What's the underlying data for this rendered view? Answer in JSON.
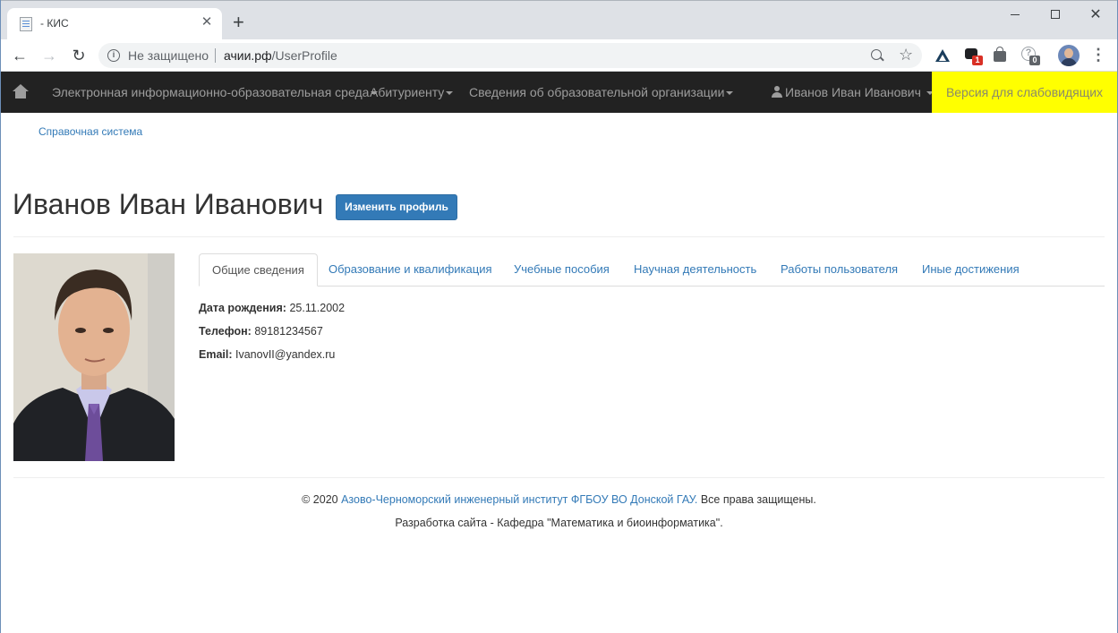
{
  "browser": {
    "tab_title": "- КИС",
    "tab_close": "✕",
    "new_tab": "+",
    "security_label": "Не защищено",
    "url_host": "ачии.рф",
    "url_path": "/UserProfile",
    "ext_badge_1": "1",
    "ext_badge_2": "0",
    "win_close": "✕"
  },
  "navbar": {
    "items": [
      {
        "label": "Электронная информационно-образовательная среда"
      },
      {
        "label": "Абитуриенту"
      },
      {
        "label": "Сведения об образовательной организации"
      }
    ],
    "user_name": "Иванов Иван Иванович",
    "a11y_label": "Версия для слабовидящих",
    "a11y_bg": "#ffff00",
    "bg_color": "#222222"
  },
  "page": {
    "help_link": "Справочная система",
    "title": "Иванов Иван Иванович",
    "edit_button": "Изменить профиль",
    "tabs": [
      {
        "label": "Общие сведения",
        "active": true
      },
      {
        "label": "Образование и квалификация"
      },
      {
        "label": "Учебные пособия"
      },
      {
        "label": "Научная деятельность"
      },
      {
        "label": "Работы пользователя"
      },
      {
        "label": "Иные достижения"
      }
    ],
    "info": {
      "dob_label": "Дата рождения:",
      "dob_value": "25.11.2002",
      "phone_label": "Телефон:",
      "phone_value": "89181234567",
      "email_label": "Email:",
      "email_value": "IvanovII@yandex.ru"
    }
  },
  "footer": {
    "copyright_prefix": "© 2020",
    "institute_link": "Азово-Черноморский инженерный институт ФГБОУ ВО Донской ГАУ.",
    "rights": "Все права защищены.",
    "dev_line": "Разработка сайта - Кафедра \"Математика и биоинформатика\"."
  },
  "colors": {
    "link": "#337ab7",
    "primary_button": "#337ab7"
  }
}
